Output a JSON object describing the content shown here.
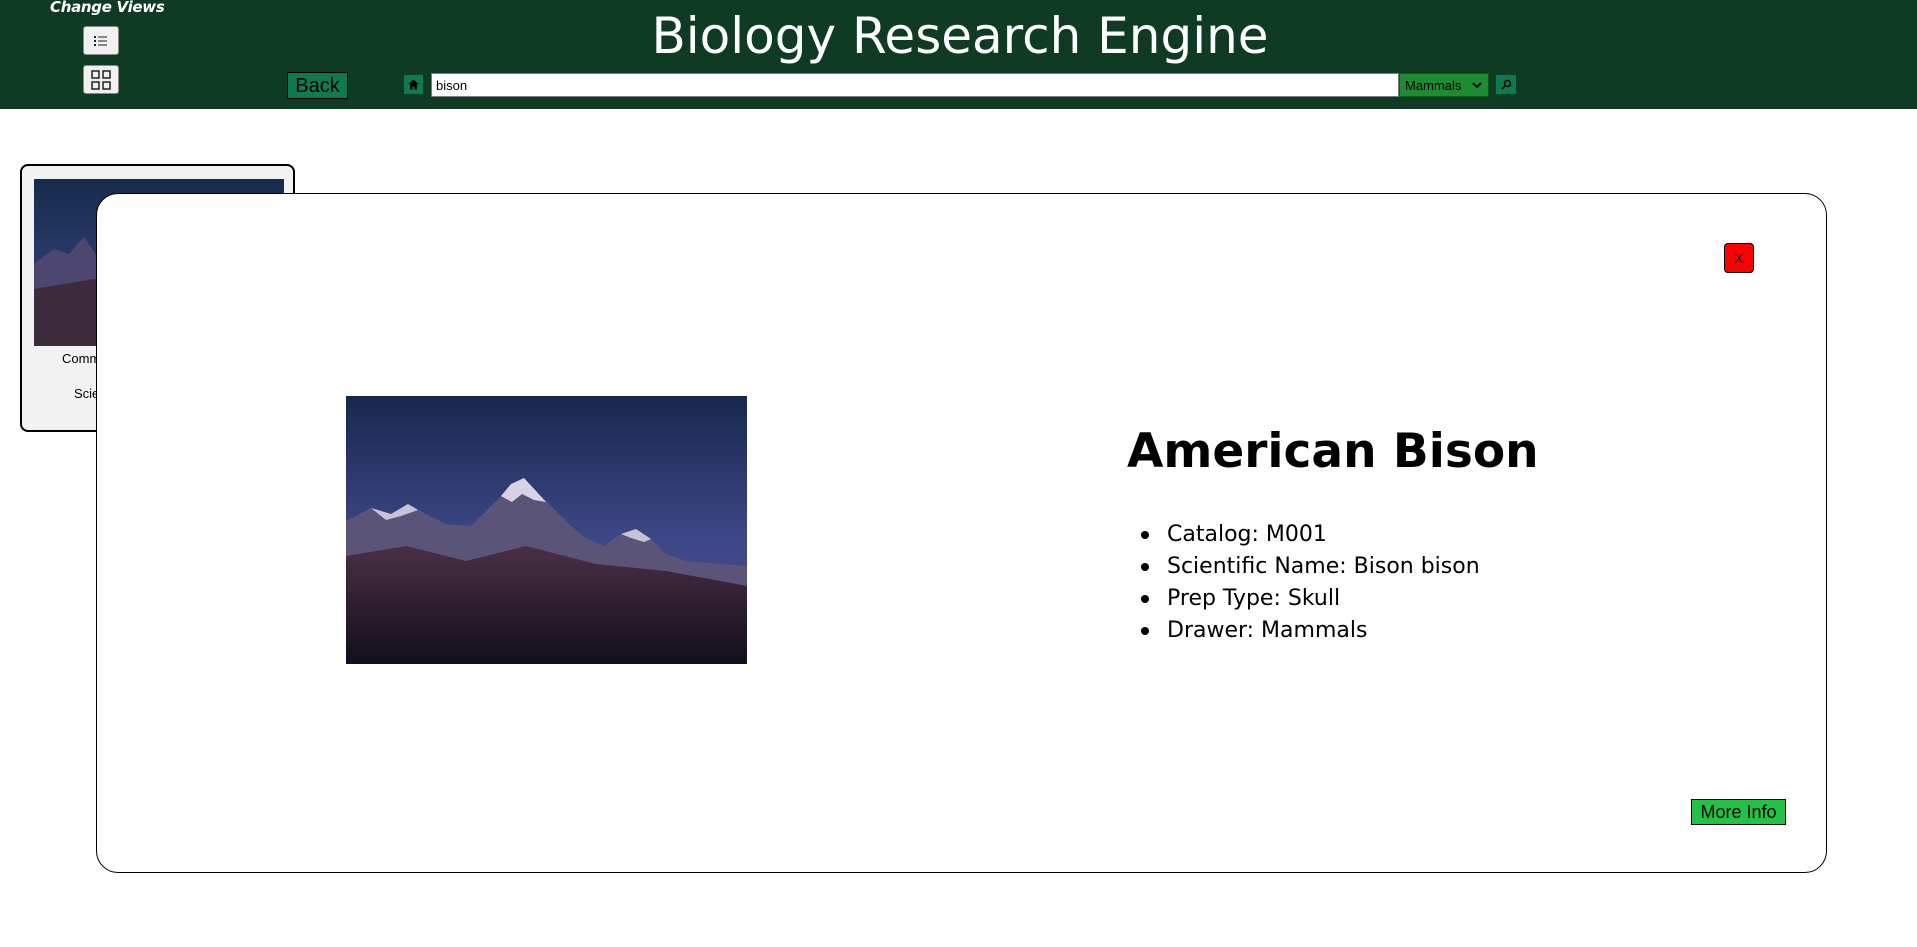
{
  "header": {
    "change_views_label": "Change Views",
    "title": "Biology Research Engine",
    "back_label": "Back",
    "search_value": "bison",
    "drawer_selected": "Mammals",
    "icons": {
      "list_view": "list-icon",
      "grid_view": "grid-icon",
      "home": "home-icon",
      "search": "search-icon"
    }
  },
  "result_card": {
    "common_label": "Comm",
    "scientific_label": "Scie"
  },
  "modal": {
    "close_label": "X",
    "title": "American Bison",
    "details": [
      "Catalog: M001",
      "Scientific Name: Bison bison",
      "Prep Type: Skull",
      "Drawer: Mammals"
    ],
    "more_info_label": "More Info"
  },
  "colors": {
    "header_bg": "#0f3b24",
    "button_green": "#0e7a4f",
    "more_info_green": "#22c244",
    "close_red": "#ff0000"
  }
}
